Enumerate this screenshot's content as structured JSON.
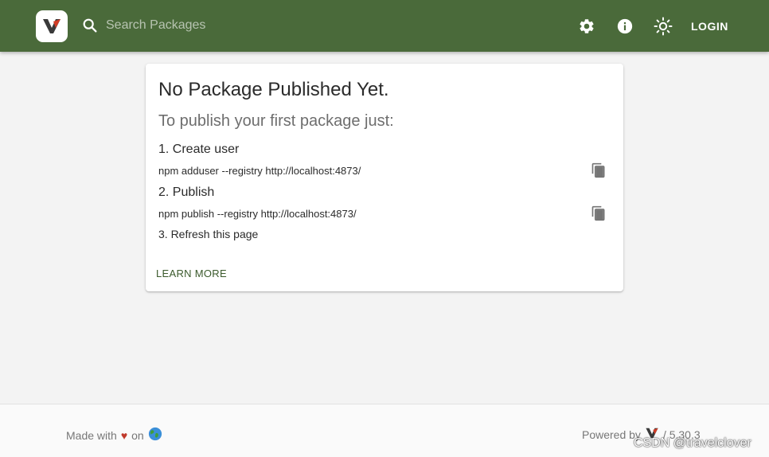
{
  "header": {
    "search": {
      "placeholder": "Search Packages"
    },
    "login_label": "LOGIN",
    "icons": [
      "verdaccio-logo-icon",
      "search-icon",
      "gear-icon",
      "info-icon",
      "sun-icon"
    ],
    "colors": {
      "background": "#4a6a3a",
      "foreground": "#ffffff"
    }
  },
  "card": {
    "title": "No Package Published Yet.",
    "subtitle": "To publish your first package just:",
    "steps": [
      {
        "heading": "1. Create user",
        "command": "npm adduser --registry http://localhost:4873/"
      },
      {
        "heading": "2. Publish",
        "command": "npm publish --registry http://localhost:4873/"
      },
      {
        "heading": "3. Refresh this page"
      }
    ],
    "learn_more": "LEARN MORE",
    "colors": {
      "link": "#3b5a2c"
    }
  },
  "footer": {
    "made_with": "Made with",
    "on": "on",
    "powered_by": "Powered by",
    "version": "/ 5.30.3",
    "icons": [
      "heart-icon",
      "globe-icon",
      "verdaccio-logo-icon"
    ]
  },
  "watermark": "CSDN @travelclover"
}
